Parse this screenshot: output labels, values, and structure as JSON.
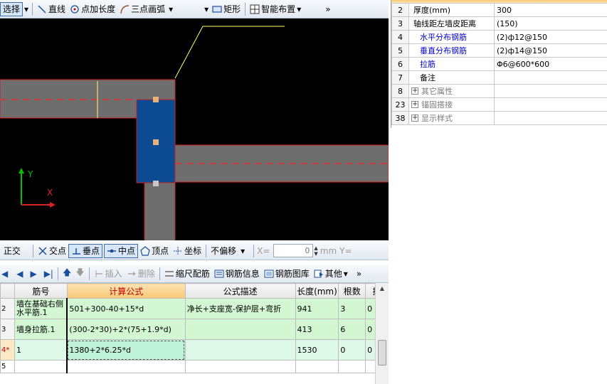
{
  "top_toolbar": {
    "select_label": "选择",
    "line_label": "直线",
    "point_length_label": "点加长度",
    "arc_label": "三点画弧",
    "rect_label": "矩形",
    "smart_layout_label": "智能布置"
  },
  "snap_toolbar": {
    "ortho_label": "正交",
    "intersection_label": "交点",
    "perpendicular_label": "垂点",
    "midpoint_label": "中点",
    "vertex_label": "顶点",
    "coordinate_label": "坐标",
    "offset_label": "不偏移",
    "x_label": "X=",
    "x_value": "0",
    "unit_label": "mm",
    "y_label": "Y="
  },
  "rebar_toolbar": {
    "insert_label": "插入",
    "delete_label": "删除",
    "scale_label": "缩尺配筋",
    "info_label": "钢筋信息",
    "library_label": "钢筋图库",
    "other_label": "其他"
  },
  "canvas": {
    "y_axis_label": "Y",
    "x_axis_label": "X"
  },
  "properties": [
    {
      "num": "2",
      "name": "厚度(mm)",
      "value": "300",
      "style": "normal"
    },
    {
      "num": "3",
      "name": "轴线距左墙皮距离",
      "value": "(150)",
      "style": "normal"
    },
    {
      "num": "4",
      "name": "水平分布钢筋",
      "value": "(2)ф12@150",
      "style": "blue"
    },
    {
      "num": "5",
      "name": "垂直分布钢筋",
      "value": "(2)ф14@150",
      "style": "blue"
    },
    {
      "num": "6",
      "name": "拉筋",
      "value": "Φ6@600*600",
      "style": "blue"
    },
    {
      "num": "7",
      "name": "备注",
      "value": "",
      "style": "normal"
    },
    {
      "num": "8",
      "name": "其它属性",
      "value": "",
      "style": "group"
    },
    {
      "num": "23",
      "name": "锚固搭接",
      "value": "",
      "style": "group"
    },
    {
      "num": "38",
      "name": "显示样式",
      "value": "",
      "style": "group"
    }
  ],
  "rebar_table": {
    "headers": [
      "筋号",
      "计算公式",
      "公式描述",
      "长度(mm)",
      "根数",
      "搭"
    ],
    "rows": [
      {
        "rn": "2",
        "name": "墙在基础右侧水平筋.1",
        "formula": "501+300-40+15*d",
        "desc": "净长+支座宽-保护层+弯折",
        "length": "941",
        "count": "3",
        "lap": "0"
      },
      {
        "rn": "3",
        "name": "墙身拉筋.1",
        "formula": "(300-2*30)+2*(75+1.9*d)",
        "desc": "",
        "length": "413",
        "count": "6",
        "lap": "0"
      },
      {
        "rn": "4*",
        "name": "1",
        "formula": "1380+2*6.25*d",
        "desc": "",
        "length": "1530",
        "count": "0",
        "lap": "0"
      },
      {
        "rn": "5",
        "name": "",
        "formula": "",
        "desc": "",
        "length": "",
        "count": "",
        "lap": ""
      }
    ]
  }
}
